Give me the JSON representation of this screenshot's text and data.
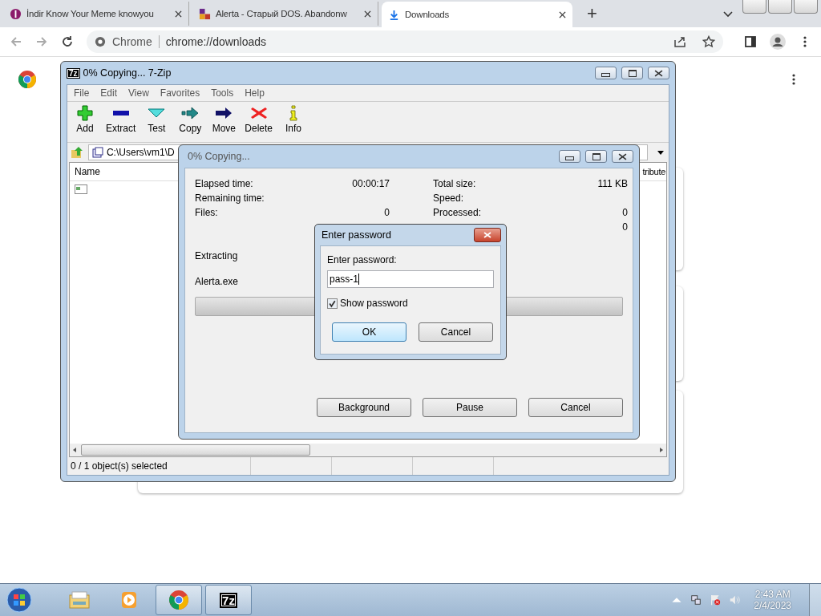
{
  "browser": {
    "tabs": [
      {
        "title": "İndir Know Your Meme knowyou",
        "kind": "meme",
        "selected": false
      },
      {
        "title": "Alerta - Старый DOS. Abandonw",
        "kind": "ms",
        "selected": false
      },
      {
        "title": "Downloads",
        "kind": "download",
        "selected": true
      }
    ],
    "new_tab": "+",
    "site_chip": "Chrome",
    "url": "chrome://downloads"
  },
  "sevenzip": {
    "title": "0% Copying... 7-Zip",
    "icon_text": "7z",
    "menu": [
      "File",
      "Edit",
      "View",
      "Favorites",
      "Tools",
      "Help"
    ],
    "toolbar": [
      {
        "label": "Add",
        "kind": "add"
      },
      {
        "label": "Extract",
        "kind": "extract"
      },
      {
        "label": "Test",
        "kind": "test"
      },
      {
        "label": "Copy",
        "kind": "copy"
      },
      {
        "label": "Move",
        "kind": "move"
      },
      {
        "label": "Delete",
        "kind": "delete"
      },
      {
        "label": "Info",
        "kind": "info"
      }
    ],
    "path": "C:\\Users\\vm1\\D",
    "columns": [
      "Name",
      "tribute"
    ],
    "status": "0 / 1 object(s) selected"
  },
  "progress": {
    "title": "0% Copying...",
    "left": [
      {
        "label": "Elapsed time:",
        "value": "00:00:17"
      },
      {
        "label": "Remaining time:"
      },
      {
        "label": "Files:",
        "value": "0"
      }
    ],
    "right": [
      {
        "label": "Total size:",
        "value": "111 KB"
      },
      {
        "label": "Speed:"
      },
      {
        "label": "Processed:",
        "value": "0"
      },
      {
        "value": "0"
      }
    ],
    "operation": "Extracting",
    "file": "Alerta.exe",
    "level": 0,
    "buttons": [
      "Background",
      "Pause",
      "Cancel"
    ]
  },
  "password": {
    "title": "Enter password",
    "label": "Enter password:",
    "value": "pass-1",
    "show_password": {
      "label": "Show password",
      "checked": true
    },
    "buttons": [
      {
        "label": "OK",
        "default": true
      },
      {
        "label": "Cancel",
        "default": false
      }
    ]
  },
  "taskbar": {
    "apps": [
      {
        "kind": "explorer",
        "running": false
      },
      {
        "kind": "media",
        "running": false
      },
      {
        "kind": "chrome",
        "running": true
      },
      {
        "kind": "sevenzip",
        "running": true,
        "icon_text": "7z"
      }
    ],
    "time": "2:43 AM",
    "date": "2/4/2023"
  }
}
